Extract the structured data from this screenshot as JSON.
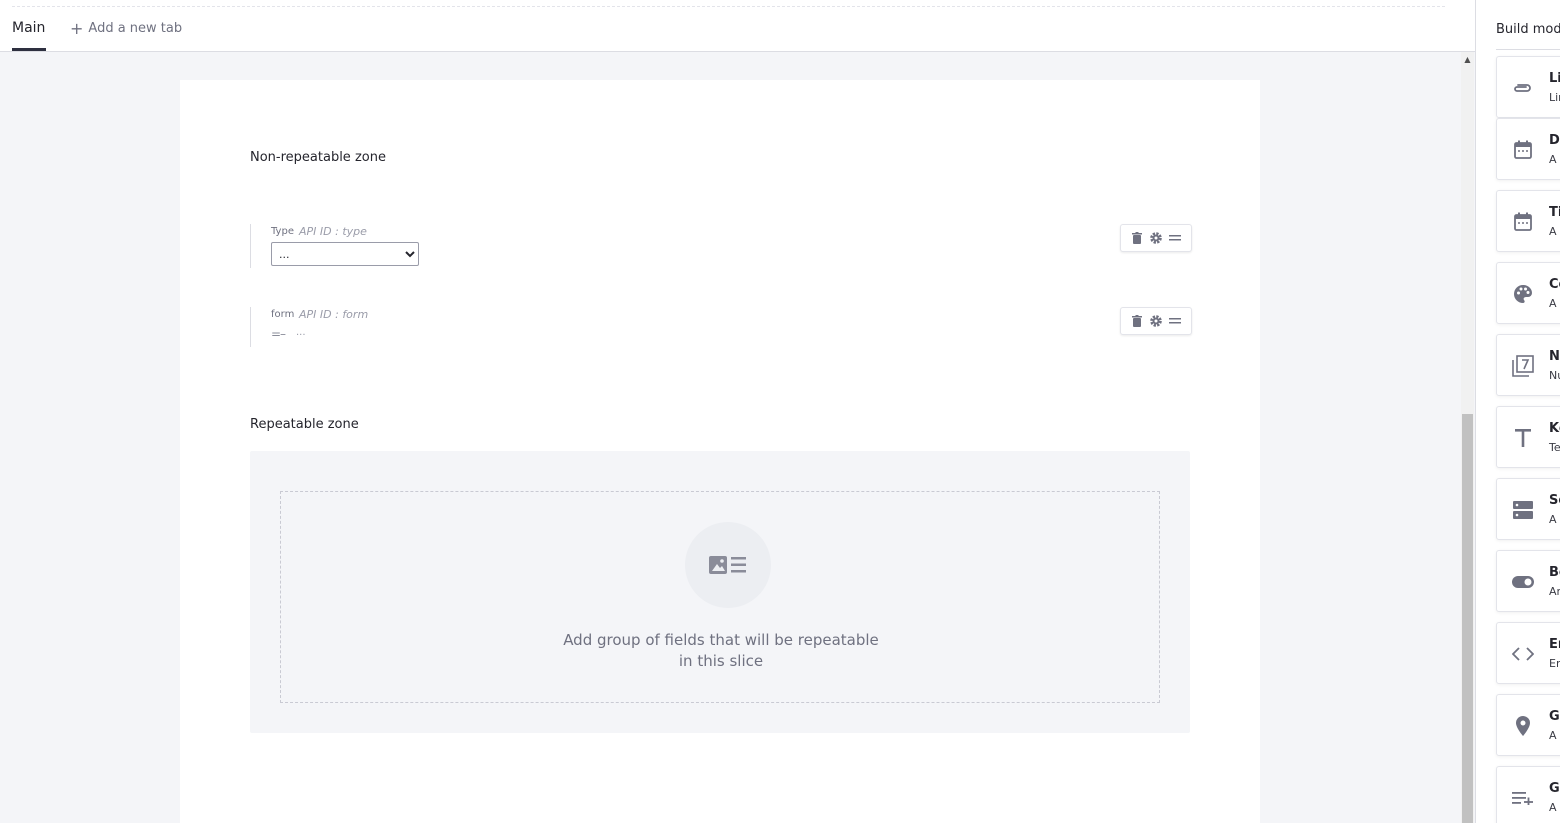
{
  "tabs": {
    "main_label": "Main",
    "add_label": "Add a new tab"
  },
  "non_repeatable": {
    "title": "Non-repeatable zone",
    "fields": [
      {
        "label": "Type",
        "api": "API ID : type",
        "value": "..."
      },
      {
        "label": "form",
        "api": "API ID : form",
        "value": "..."
      }
    ]
  },
  "repeatable": {
    "title": "Repeatable zone",
    "empty_line1": "Add group of fields that will be repeatable",
    "empty_line2": "in this slice"
  },
  "panel": {
    "title": "Build mode",
    "widgets": [
      {
        "name": "Link",
        "desc": "Link",
        "icon": "paperclip-icon"
      },
      {
        "name": "Date",
        "desc": "A date",
        "icon": "calendar-icon"
      },
      {
        "name": "Timestamp",
        "desc": "A date and time",
        "icon": "calendar-icon"
      },
      {
        "name": "Color",
        "desc": "A color",
        "icon": "palette-icon"
      },
      {
        "name": "Number",
        "desc": "Number",
        "icon": "number-icon"
      },
      {
        "name": "Key Text",
        "desc": "Text",
        "icon": "text-icon"
      },
      {
        "name": "Select",
        "desc": "A select",
        "icon": "select-icon"
      },
      {
        "name": "Boolean",
        "desc": "An on/off",
        "icon": "toggle-icon"
      },
      {
        "name": "Embed",
        "desc": "Embed",
        "icon": "code-icon"
      },
      {
        "name": "GeoPoint",
        "desc": "A field",
        "icon": "map-pin-icon"
      },
      {
        "name": "Group",
        "desc": "A group",
        "icon": "group-icon"
      }
    ]
  },
  "colors": {
    "icon": "#6f7180",
    "accent": "#2e3040"
  }
}
